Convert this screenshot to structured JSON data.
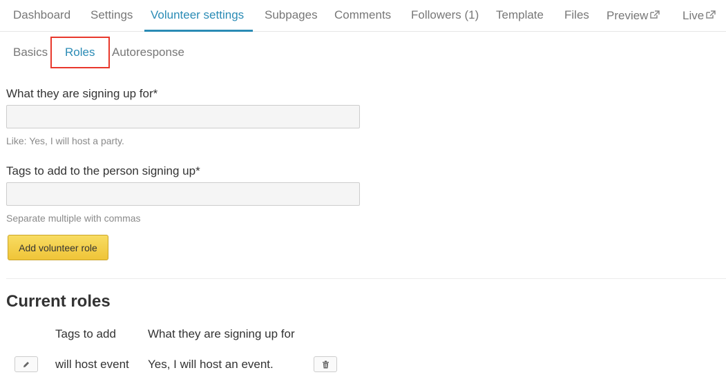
{
  "nav": {
    "tabs": [
      {
        "label": "Dashboard"
      },
      {
        "label": "Settings"
      },
      {
        "label": "Volunteer settings"
      },
      {
        "label": "Subpages"
      },
      {
        "label": "Comments"
      },
      {
        "label": "Followers (1)"
      },
      {
        "label": "Template"
      },
      {
        "label": "Files"
      },
      {
        "label": "Preview",
        "icon": "external-link-icon"
      },
      {
        "label": "Live",
        "icon": "external-link-icon"
      }
    ],
    "active_tab": "Volunteer settings"
  },
  "subnav": {
    "tabs": [
      {
        "label": "Basics"
      },
      {
        "label": "Roles"
      },
      {
        "label": "Autoresponse"
      }
    ],
    "active_tab": "Roles"
  },
  "form": {
    "signing_up_label": "What they are signing up for*",
    "signing_up_value": "",
    "signing_up_help": "Like: Yes, I will host a party.",
    "tags_label": "Tags to add to the person signing up*",
    "tags_value": "",
    "tags_help": "Separate multiple with commas",
    "submit_label": "Add volunteer role"
  },
  "current_roles": {
    "title": "Current roles",
    "columns": [
      "Tags to add",
      "What they are signing up for"
    ],
    "rows": [
      {
        "tags": "will host event",
        "signing_up_for": "Yes, I will host an event.",
        "edit_icon": "pencil-icon",
        "delete_icon": "trash-icon"
      }
    ]
  },
  "colors": {
    "accent": "#2a8bb5",
    "highlight": "#e8372b",
    "button": "#efc438"
  }
}
